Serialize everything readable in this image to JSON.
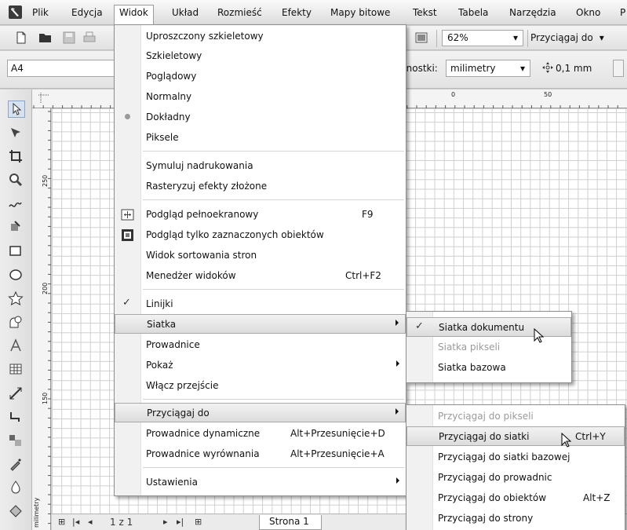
{
  "menubar": {
    "items": [
      {
        "label": "Plik",
        "underline": "P"
      },
      {
        "label": "Edycja",
        "underline": "E"
      },
      {
        "label": "Widok",
        "underline": "W"
      },
      {
        "label": "Układ",
        "underline": "U"
      },
      {
        "label": "Rozmieść",
        "underline": "R"
      },
      {
        "label": "Efekty",
        "underline": "k"
      },
      {
        "label": "Mapy bitowe",
        "underline": "M"
      },
      {
        "label": "Tekst",
        "underline": "T"
      },
      {
        "label": "Tabela",
        "underline": "T"
      },
      {
        "label": "Narzędzia",
        "underline": "z"
      },
      {
        "label": "Okno",
        "underline": "O"
      },
      {
        "label": "P"
      }
    ]
  },
  "toolbar": {
    "zoom": "62%",
    "snap_label": "Przyciągaj do"
  },
  "propbar": {
    "page_size": "A4",
    "units_label": "dnostki:",
    "units_value": "milimetry",
    "nudge_value": "0,1 mm"
  },
  "ruler": {
    "h_labels": [
      "0",
      "50"
    ],
    "v_labels": [
      "250",
      "200",
      "150"
    ],
    "units": "milimetry"
  },
  "statusbar": {
    "page_counter": "1 z 1",
    "page_tab": "Strona 1"
  },
  "view_menu": {
    "items": [
      {
        "label": "Uproszczony szkieletowy"
      },
      {
        "label": "Szkieletowy"
      },
      {
        "label": "Poglądowy"
      },
      {
        "label": "Normalny"
      },
      {
        "label": "Dokładny",
        "state": "selected-radio"
      },
      {
        "label": "Piksele"
      },
      {
        "label": "Symuluj nadrukowania"
      },
      {
        "label": "Rasteryzuj efekty złożone"
      },
      {
        "label": "Podgląd pełnoekranowy",
        "shortcut": "F9",
        "icon": "fullscreen-preview-icon"
      },
      {
        "label": "Podgląd tylko zaznaczonych obiektów",
        "icon": "selected-preview-icon"
      },
      {
        "label": "Widok sortowania stron"
      },
      {
        "label": "Menedżer widoków",
        "shortcut": "Ctrl+F2"
      },
      {
        "label": "Linijki",
        "state": "checked"
      },
      {
        "label": "Siatka",
        "submenu": true
      },
      {
        "label": "Prowadnice"
      },
      {
        "label": "Pokaż",
        "submenu": true
      },
      {
        "label": "Włącz przejście"
      },
      {
        "label": "Przyciągaj do",
        "submenu": true
      },
      {
        "label": "Prowadnice dynamiczne",
        "shortcut": "Alt+Przesunięcie+D"
      },
      {
        "label": "Prowadnice wyrównania",
        "shortcut": "Alt+Przesunięcie+A"
      },
      {
        "label": "Ustawienia",
        "submenu": true
      }
    ]
  },
  "grid_submenu": {
    "items": [
      {
        "label": "Siatka dokumentu",
        "state": "checked"
      },
      {
        "label": "Siatka pikseli",
        "disabled": true
      },
      {
        "label": "Siatka bazowa"
      }
    ]
  },
  "snap_submenu": {
    "items": [
      {
        "label": "Przyciągaj do pikseli",
        "disabled": true
      },
      {
        "label": "Przyciągaj do siatki",
        "shortcut": "Ctrl+Y"
      },
      {
        "label": "Przyciągaj do siatki bazowej"
      },
      {
        "label": "Przyciągaj do prowadnic"
      },
      {
        "label": "Przyciągaj do obiektów",
        "shortcut": "Alt+Z"
      },
      {
        "label": "Przyciągaj do strony"
      }
    ]
  }
}
